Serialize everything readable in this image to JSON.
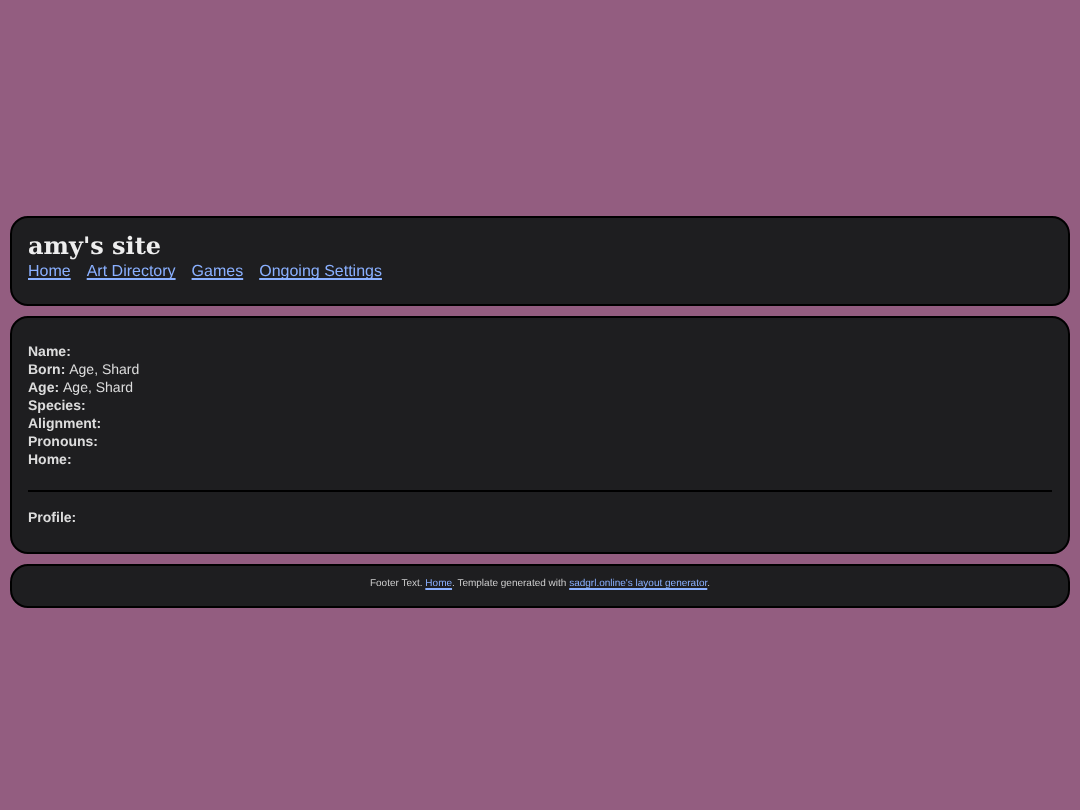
{
  "header": {
    "title": "amy's site",
    "nav": [
      {
        "label": "Home"
      },
      {
        "label": "Art Directory"
      },
      {
        "label": "Games"
      },
      {
        "label": "Ongoing Settings"
      }
    ]
  },
  "profile": {
    "fields": [
      {
        "label": "Name:"
      },
      {
        "label": "Born:",
        "value": "Age, Shard"
      },
      {
        "label": "Age:",
        "value": "Age, Shard"
      },
      {
        "label": "Species:"
      },
      {
        "label": "Alignment:"
      },
      {
        "label": "Pronouns:"
      },
      {
        "label": "Home:"
      }
    ],
    "section_label": "Profile:"
  },
  "footer": {
    "parts": [
      {
        "kind": "text",
        "text": "Footer Text. "
      },
      {
        "kind": "link",
        "text": "Home"
      },
      {
        "kind": "text",
        "text": ". Template generated with "
      },
      {
        "kind": "link",
        "text": "sadgrl.online's layout generator"
      },
      {
        "kind": "text",
        "text": "."
      }
    ]
  }
}
